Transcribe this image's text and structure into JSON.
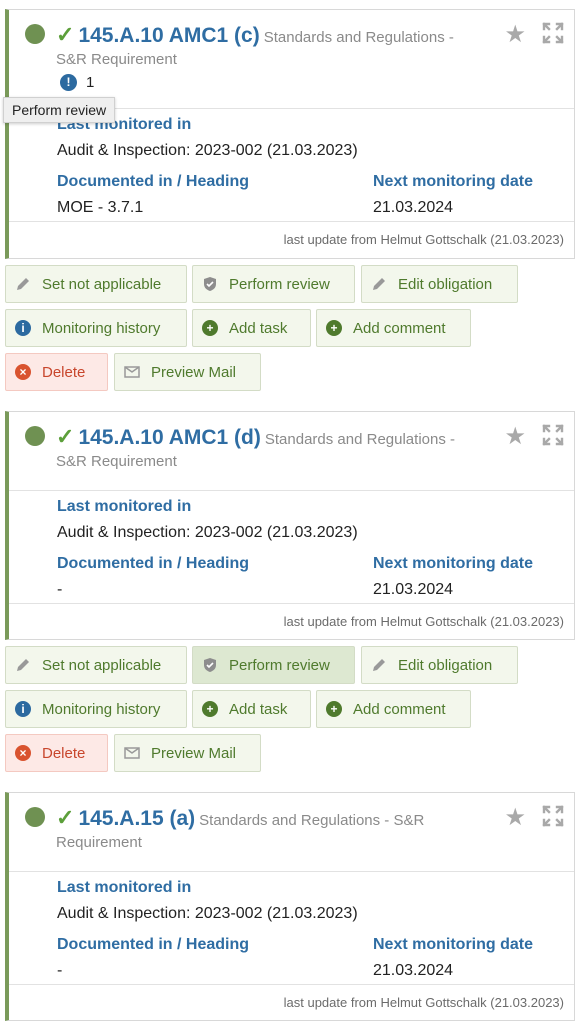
{
  "tooltip": "Perform review",
  "cards": [
    {
      "id": "145.A.10 AMC1 (c)",
      "category": "Standards and Regulations -",
      "category_cont": "S&R Requirement",
      "issue_count": "1",
      "last_monitored_label": "Last monitored in",
      "last_monitored_value": "Audit & Inspection: 2023-002 (21.03.2023)",
      "documented_label": "Documented in / Heading",
      "documented_value": "MOE - 3.7.1",
      "next_label": "Next monitoring date",
      "next_value": "21.03.2024",
      "last_update": "last update from Helmut Gottschalk (21.03.2023)"
    },
    {
      "id": "145.A.10 AMC1 (d)",
      "category": "Standards and Regulations -",
      "category_cont": "S&R Requirement",
      "last_monitored_label": "Last monitored in",
      "last_monitored_value": "Audit & Inspection: 2023-002 (21.03.2023)",
      "documented_label": "Documented in / Heading",
      "documented_value": "-",
      "next_label": "Next monitoring date",
      "next_value": "21.03.2024",
      "last_update": "last update from Helmut Gottschalk (21.03.2023)"
    },
    {
      "id": "145.A.15 (a)",
      "category": "Standards and Regulations - S&R",
      "category_cont": "Requirement",
      "last_monitored_label": "Last monitored in",
      "last_monitored_value": "Audit & Inspection: 2023-002 (21.03.2023)",
      "documented_label": "Documented in / Heading",
      "documented_value": "-",
      "next_label": "Next monitoring date",
      "next_value": "21.03.2024",
      "last_update": "last update from Helmut Gottschalk (21.03.2023)"
    }
  ],
  "actions": {
    "set_not_applicable": "Set not applicable",
    "perform_review": "Perform review",
    "edit_obligation": "Edit obligation",
    "monitoring_history": "Monitoring history",
    "add_task": "Add task",
    "add_comment": "Add comment",
    "delete": "Delete",
    "preview_mail": "Preview Mail"
  },
  "colors": {
    "accent_blue": "#2f6da3",
    "status_green": "#6f9152",
    "button_green": "#4f7a2d",
    "danger_red": "#c8462c"
  },
  "icons": {
    "status": "status-dot-icon",
    "check": "checkmark-icon",
    "star": "star-icon",
    "expand": "expand-icon",
    "warning": "exclamation-icon",
    "pencil": "pencil-icon",
    "shield": "shield-check-icon",
    "info": "info-icon",
    "plus": "plus-circle-icon",
    "delete": "x-circle-icon",
    "mail": "mail-icon"
  }
}
